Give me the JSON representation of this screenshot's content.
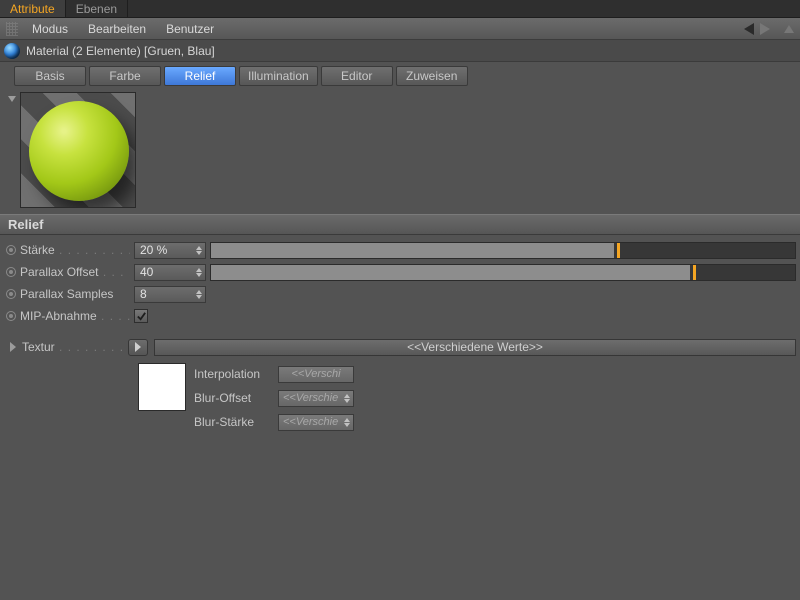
{
  "topTabs": {
    "attribute": "Attribute",
    "ebenen": "Ebenen"
  },
  "menu": {
    "modus": "Modus",
    "bearbeiten": "Bearbeiten",
    "benutzer": "Benutzer"
  },
  "title": "Material (2 Elemente) [Gruen, Blau]",
  "channelTabs": {
    "basis": "Basis",
    "farbe": "Farbe",
    "relief": "Relief",
    "illumination": "Illumination",
    "editor": "Editor",
    "zuweisen": "Zuweisen"
  },
  "section": "Relief",
  "params": {
    "staerke": {
      "label": "Stärke",
      "value": "20 %",
      "fillPct": 69,
      "tickPct": 69.5
    },
    "parallaxOffset": {
      "label": "Parallax Offset",
      "value": "40",
      "fillPct": 82,
      "tickPct": 82.5
    },
    "parallaxSamples": {
      "label": "Parallax Samples",
      "value": "8"
    },
    "mip": {
      "label": "MIP-Abnahme",
      "checked": true
    }
  },
  "textur": {
    "label": "Textur",
    "value": "<<Verschiedene Werte>>",
    "fields": {
      "interpolation": {
        "label": "Interpolation",
        "value": "<<Verschi"
      },
      "blurOffset": {
        "label": "Blur-Offset",
        "value": "<<Verschie"
      },
      "blurStaerke": {
        "label": "Blur-Stärke",
        "value": "<<Verschie"
      }
    }
  }
}
